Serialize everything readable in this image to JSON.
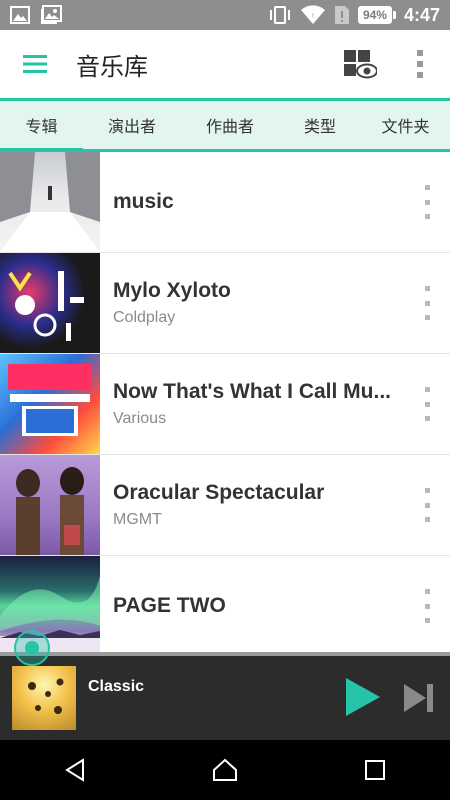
{
  "status_bar": {
    "time": "4:47",
    "battery": "94%",
    "icons": [
      "image-icon",
      "photo-icon",
      "vibrate-icon",
      "wifi-icon",
      "sim-alert-icon"
    ]
  },
  "app_bar": {
    "title": "音乐库",
    "icons": [
      "menu-icon",
      "visualizer-icon",
      "more-vert-icon"
    ]
  },
  "tabs": [
    {
      "label": "专辑",
      "active": true
    },
    {
      "label": "演出者",
      "active": false
    },
    {
      "label": "作曲者",
      "active": false
    },
    {
      "label": "类型",
      "active": false
    },
    {
      "label": "文件夹",
      "active": false
    }
  ],
  "albums": [
    {
      "title": "music",
      "artist": ""
    },
    {
      "title": "Mylo Xyloto",
      "artist": "Coldplay"
    },
    {
      "title": "Now That's What I Call Mu...",
      "artist": "Various"
    },
    {
      "title": "Oracular Spectacular",
      "artist": "MGMT"
    },
    {
      "title": "PAGE TWO",
      "artist": ""
    }
  ],
  "player": {
    "title": "Classic"
  },
  "accent_color": "#26c4a6",
  "nav": [
    "back-icon",
    "home-icon",
    "recents-icon"
  ]
}
